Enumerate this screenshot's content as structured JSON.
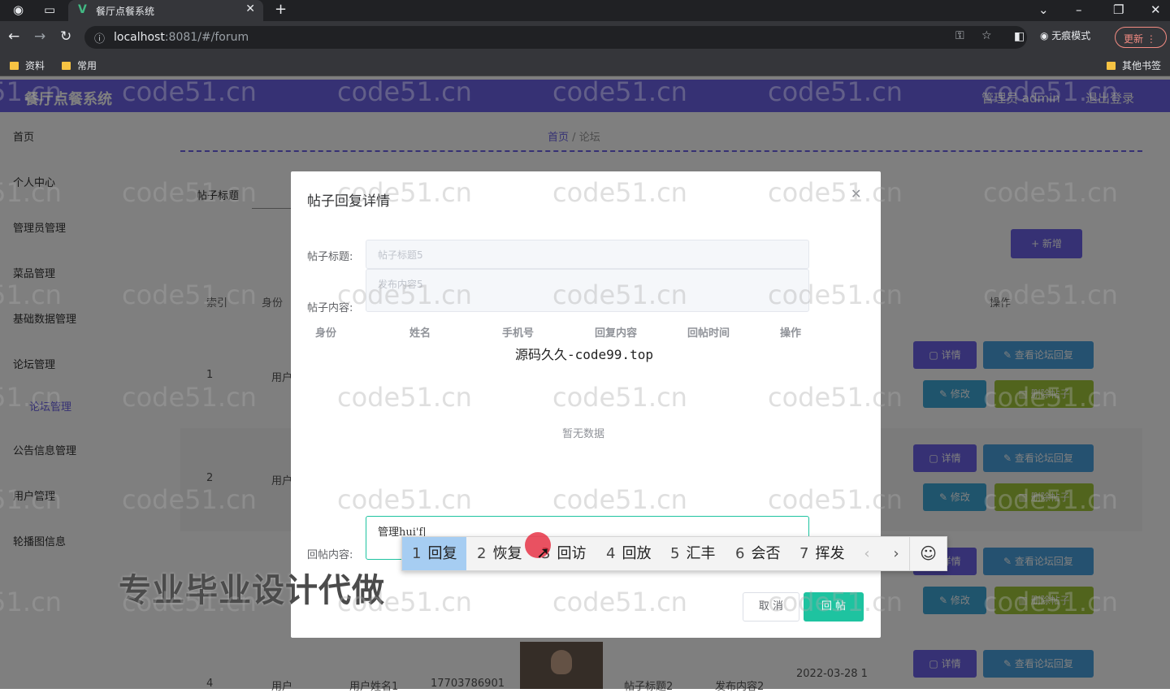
{
  "browser": {
    "tab_title": "餐厅点餐系统",
    "url_host": "localhost",
    "url_rest": ":8081/#/forum",
    "incognito_label": "无痕模式",
    "update_label": "更新",
    "bookmarks": [
      "资料",
      "常用"
    ],
    "other_bookmarks": "其他书签"
  },
  "app": {
    "title": "餐厅点餐系统",
    "user": "管理员 admin",
    "logout": "退出登录"
  },
  "sidebar": {
    "items": [
      "首页",
      "个人中心",
      "管理员管理",
      "菜品管理",
      "基础数据管理",
      "论坛管理",
      "公告信息管理",
      "用户管理",
      "轮播图信息"
    ],
    "sub_item": "论坛管理"
  },
  "page": {
    "breadcrumb_home": "首页",
    "breadcrumb_current": "论坛",
    "filter_label": "帖子标题",
    "add_button": "+ 新增",
    "columns": [
      "索引",
      "身份",
      "操作"
    ],
    "rows": [
      {
        "index": "1",
        "role": "用户"
      },
      {
        "index": "2",
        "role": "用户"
      },
      {
        "index": "4",
        "role": "用户",
        "name": "用户姓名1",
        "phone": "17703786901",
        "title": "帖子标题2",
        "content": "发布内容2",
        "time": "2022-03-28 1"
      }
    ],
    "btn_detail": "详情",
    "btn_view_replies": "查看论坛回复",
    "btn_edit": "修改",
    "btn_delete": "删除帖子"
  },
  "dialog": {
    "title": "帖子回复详情",
    "label_post_title": "帖子标题:",
    "label_post_content": "帖子内容:",
    "post_title_value": "帖子标题5",
    "post_content_value": "发布内容5",
    "table_columns": [
      "身份",
      "姓名",
      "手机号",
      "回复内容",
      "回帖时间",
      "操作"
    ],
    "credit": "源码久久-code99.top",
    "empty_text": "暂无数据",
    "label_reply": "回帖内容:",
    "reply_value": "管理hui'f|",
    "cancel": "取 消",
    "submit": "回 帖"
  },
  "ime": {
    "candidates": [
      {
        "num": "1",
        "text": "回复"
      },
      {
        "num": "2",
        "text": "恢复"
      },
      {
        "num": "3",
        "text": "回访"
      },
      {
        "num": "4",
        "text": "回放"
      },
      {
        "num": "5",
        "text": "汇丰"
      },
      {
        "num": "6",
        "text": "会否"
      },
      {
        "num": "7",
        "text": "挥发"
      }
    ],
    "prev": "‹",
    "next": "›",
    "emoji": "☺"
  },
  "overlay_text": "专业毕业设计代做",
  "watermark_text": "code51.cn",
  "colors": {
    "primary": "#6c63e8",
    "success": "#1ec3a0",
    "info": "#4aa3e0",
    "warning": "#a3c93a"
  }
}
